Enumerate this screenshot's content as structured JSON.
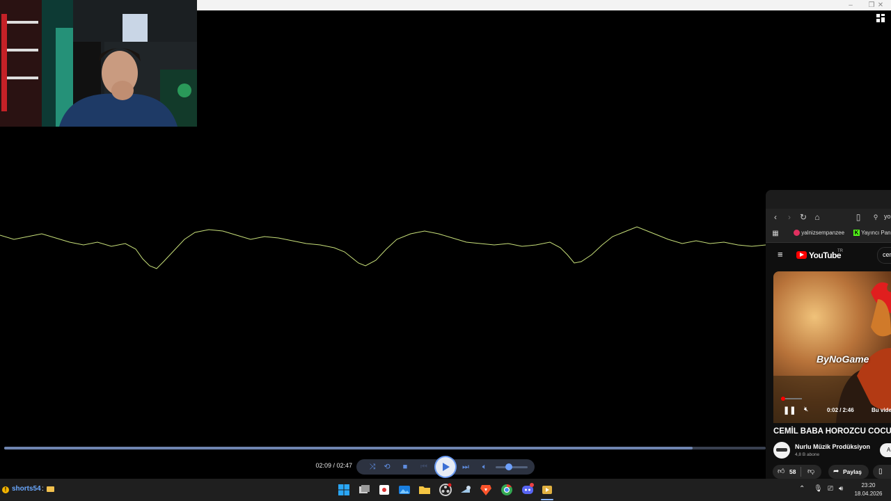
{
  "window": {
    "minimize_glyph": "–",
    "maximize_glyph": "❐",
    "close_glyph": "✕"
  },
  "player": {
    "time": "02:09 / 02:47",
    "progress": 0.904
  },
  "browser": {
    "address_partial": "yo",
    "bookmarks": [
      {
        "label": "yalnizsempanzee",
        "icon": "youtube-icon"
      },
      {
        "label": "Yayıncı Pan",
        "icon": "kick-icon"
      }
    ],
    "youtube": {
      "logo_text": "YouTube",
      "region": "TR",
      "search_partial": "cem"
    },
    "video": {
      "watermark": "ByNoGame",
      "time": "0:02 / 2:46",
      "overlay_text": "Bu video",
      "title": "CEMİL BABA HOROZCU COCUĞ",
      "channel": "Nurlu Müzik Prodüksiyon",
      "subscribers": "4,8 B abone",
      "subscribe_partial": "A",
      "likes": "58",
      "share_label": "Paylaş"
    }
  },
  "taskbar": {
    "left_label": "shorts54",
    "left_sep": ":",
    "time": "23:20",
    "date": "18.04.2026",
    "apps": [
      "windows-start",
      "task-view",
      "snipping-tool",
      "photos",
      "file-explorer",
      "obs-studio",
      "steam",
      "brave",
      "chrome",
      "discord",
      "media-player"
    ]
  }
}
